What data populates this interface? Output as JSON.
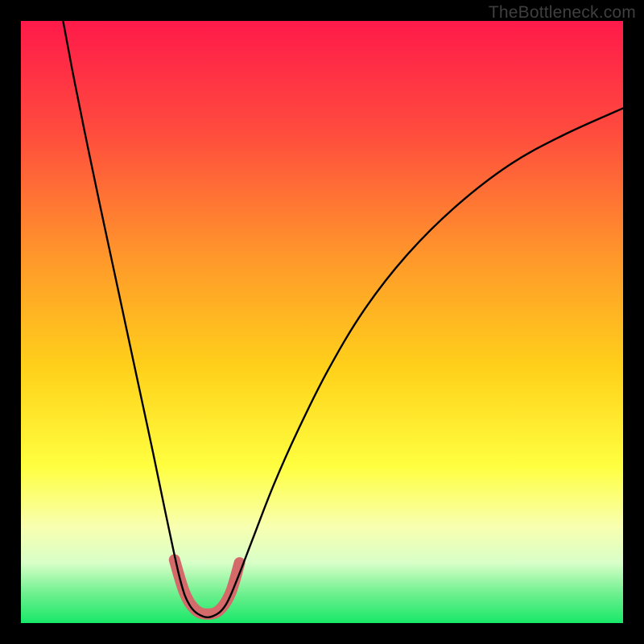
{
  "attribution": "TheBottleneck.com",
  "chart_data": {
    "type": "line",
    "title": "",
    "xlabel": "",
    "ylabel": "",
    "xlim": [
      0,
      100
    ],
    "ylim": [
      0,
      100
    ],
    "gradient_stops": [
      {
        "offset": 0.0,
        "color": "#ff1a4a"
      },
      {
        "offset": 0.18,
        "color": "#ff4a3e"
      },
      {
        "offset": 0.4,
        "color": "#ff9a2a"
      },
      {
        "offset": 0.58,
        "color": "#ffd21a"
      },
      {
        "offset": 0.74,
        "color": "#ffff40"
      },
      {
        "offset": 0.84,
        "color": "#f8ffb0"
      },
      {
        "offset": 0.9,
        "color": "#d8ffc8"
      },
      {
        "offset": 0.95,
        "color": "#70f090"
      },
      {
        "offset": 1.0,
        "color": "#18e868"
      }
    ],
    "series": [
      {
        "name": "bottleneck-curve",
        "stroke": "#000000",
        "stroke_width": 2.4,
        "points": [
          {
            "x": 7.0,
            "y": 100.0
          },
          {
            "x": 8.5,
            "y": 92.0
          },
          {
            "x": 10.5,
            "y": 82.0
          },
          {
            "x": 13.0,
            "y": 70.0
          },
          {
            "x": 16.0,
            "y": 56.0
          },
          {
            "x": 19.0,
            "y": 42.0
          },
          {
            "x": 22.0,
            "y": 28.0
          },
          {
            "x": 24.5,
            "y": 16.0
          },
          {
            "x": 26.5,
            "y": 7.0
          },
          {
            "x": 28.0,
            "y": 3.0
          },
          {
            "x": 30.0,
            "y": 1.2
          },
          {
            "x": 32.0,
            "y": 1.2
          },
          {
            "x": 34.0,
            "y": 3.0
          },
          {
            "x": 36.0,
            "y": 7.5
          },
          {
            "x": 38.5,
            "y": 14.0
          },
          {
            "x": 42.0,
            "y": 23.0
          },
          {
            "x": 46.0,
            "y": 32.0
          },
          {
            "x": 51.0,
            "y": 42.0
          },
          {
            "x": 57.0,
            "y": 52.0
          },
          {
            "x": 64.0,
            "y": 61.0
          },
          {
            "x": 72.0,
            "y": 69.0
          },
          {
            "x": 81.0,
            "y": 76.0
          },
          {
            "x": 90.0,
            "y": 81.0
          },
          {
            "x": 100.0,
            "y": 85.5
          }
        ]
      },
      {
        "name": "minimum-highlight",
        "stroke": "#d46a6a",
        "stroke_width": 14,
        "points": [
          {
            "x": 25.5,
            "y": 10.5
          },
          {
            "x": 27.2,
            "y": 5.0
          },
          {
            "x": 29.0,
            "y": 2.2
          },
          {
            "x": 31.0,
            "y": 1.5
          },
          {
            "x": 33.0,
            "y": 2.2
          },
          {
            "x": 34.8,
            "y": 5.0
          },
          {
            "x": 36.3,
            "y": 10.0
          }
        ]
      }
    ]
  }
}
